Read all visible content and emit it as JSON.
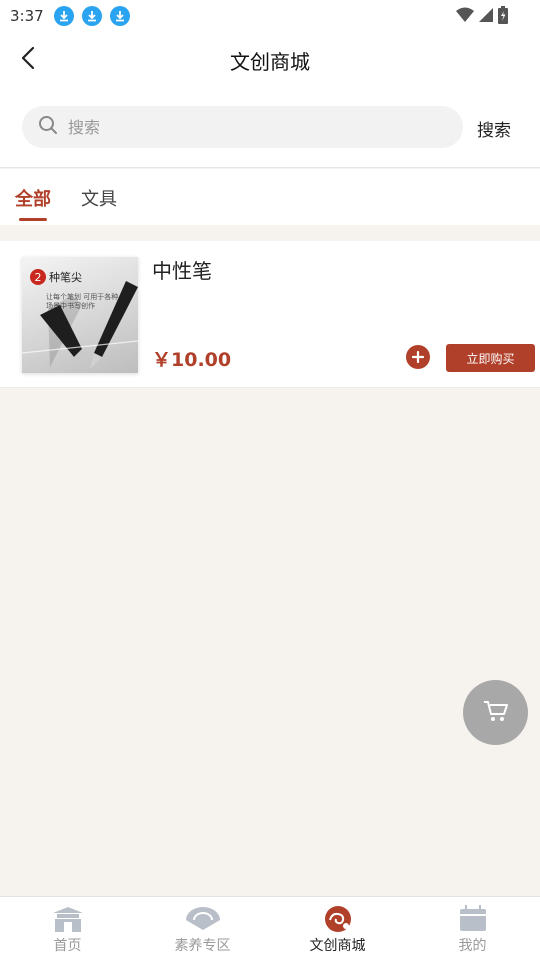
{
  "status_bar": {
    "time": "3:37",
    "download_icons": [
      "download-icon",
      "download-icon",
      "download-icon"
    ]
  },
  "header": {
    "title": "文创商城",
    "back_icon": "back-icon"
  },
  "search": {
    "placeholder": "搜索",
    "button_label": "搜索"
  },
  "tabs": [
    {
      "label": "全部",
      "active": true
    },
    {
      "label": "文具",
      "active": false
    }
  ],
  "products": [
    {
      "name": "中性笔",
      "price": "￥10.00",
      "buy_label": "立即购买",
      "thumb": {
        "badge_number": "2",
        "badge_text": "种笔尖",
        "caption_1": "让每个笔划 可用于各种",
        "caption_2": "场景中书写创作"
      }
    }
  ],
  "nav": [
    {
      "label": "首页",
      "icon": "gate-icon",
      "active": false
    },
    {
      "label": "素养专区",
      "icon": "fan-icon",
      "active": false
    },
    {
      "label": "文创商城",
      "icon": "cloud-emblem-icon",
      "active": true
    },
    {
      "label": "我的",
      "icon": "profile-icon",
      "active": false
    }
  ],
  "colors": {
    "accent": "#b0402a",
    "fab": "#a8a8a8",
    "inactive_nav": "#9a9a9a"
  }
}
